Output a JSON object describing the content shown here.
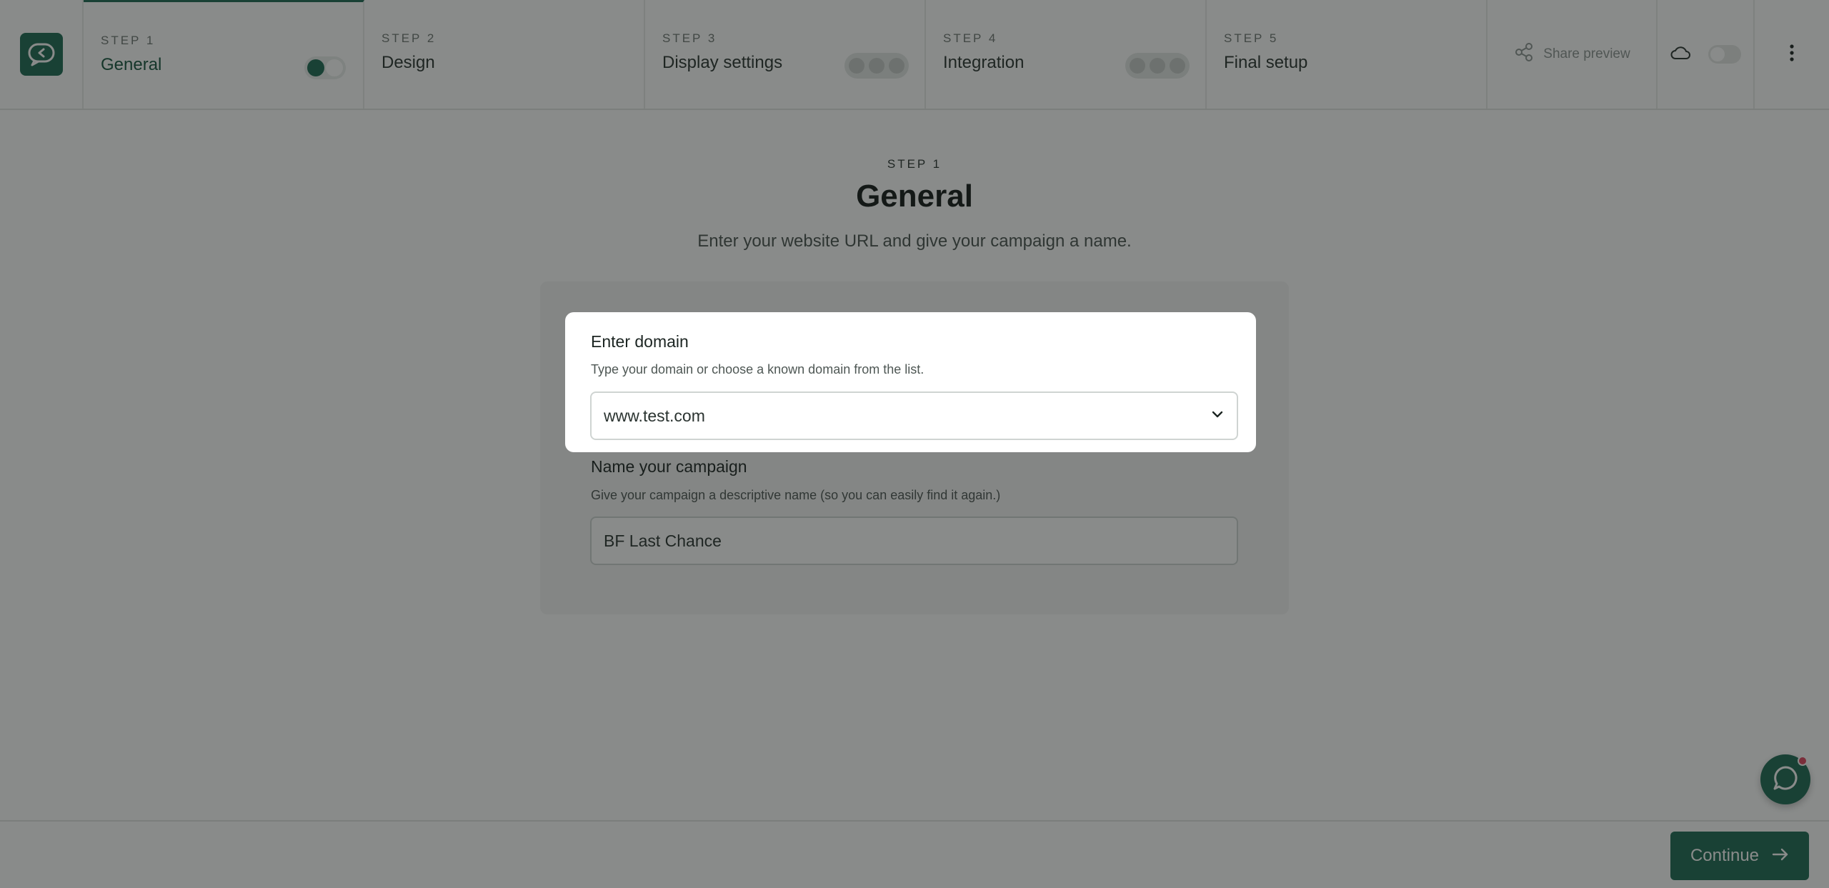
{
  "steps": [
    {
      "kicker": "STEP 1",
      "title": "General"
    },
    {
      "kicker": "STEP 2",
      "title": "Design"
    },
    {
      "kicker": "STEP 3",
      "title": "Display settings"
    },
    {
      "kicker": "STEP 4",
      "title": "Integration"
    },
    {
      "kicker": "STEP 5",
      "title": "Final setup"
    }
  ],
  "toolbar": {
    "share_label": "Share preview"
  },
  "hero": {
    "kicker": "STEP 1",
    "title": "General",
    "subtitle": "Enter your website URL and give your campaign a name."
  },
  "domain_field": {
    "label": "Enter domain",
    "help": "Type your domain or choose a known domain from the list.",
    "value": "www.test.com"
  },
  "campaign_field": {
    "label": "Name your campaign",
    "help": "Give your campaign a descriptive name (so you can easily find it again.)",
    "value": "BF Last Chance"
  },
  "footer": {
    "continue_label": "Continue"
  },
  "icons": {
    "logo": "chat-bubble-logo-icon",
    "share": "share-icon",
    "cloud": "cloud-icon",
    "more": "more-vertical-icon",
    "chevron": "chevron-down-icon",
    "arrow": "arrow-right-icon",
    "chat": "chat-icon"
  },
  "colors": {
    "brand": "#1f6b55",
    "notification": "#e0455f"
  }
}
